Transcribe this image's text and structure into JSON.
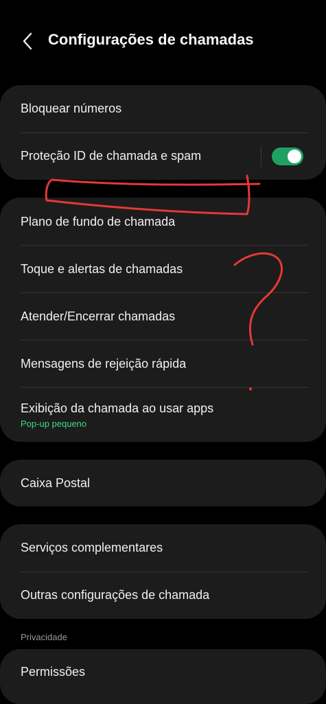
{
  "header": {
    "title": "Configurações de chamadas",
    "back_icon": "chevron-left-icon"
  },
  "card1": {
    "items": [
      {
        "label": "Bloquear números"
      },
      {
        "label": "Proteção ID de chamada e spam",
        "toggle_on": true
      }
    ]
  },
  "card2": {
    "items": [
      {
        "label": "Plano de fundo de chamada"
      },
      {
        "label": "Toque e alertas de chamadas"
      },
      {
        "label": "Atender/Encerrar chamadas"
      },
      {
        "label": "Mensagens de rejeição rápida"
      },
      {
        "label": "Exibição da chamada ao usar apps",
        "sublabel": "Pop-up pequeno"
      }
    ]
  },
  "card3": {
    "items": [
      {
        "label": "Caixa Postal"
      }
    ]
  },
  "card4": {
    "items": [
      {
        "label": "Serviços complementares"
      },
      {
        "label": "Outras configurações de chamada"
      }
    ]
  },
  "privacy": {
    "section_label": "Privacidade",
    "items": [
      {
        "label": "Permissões"
      }
    ]
  },
  "colors": {
    "background": "#000000",
    "card": "#1c1c1c",
    "accent_green": "#3ddc84",
    "toggle_on": "#1fa163",
    "annotation_red": "#e53935"
  }
}
